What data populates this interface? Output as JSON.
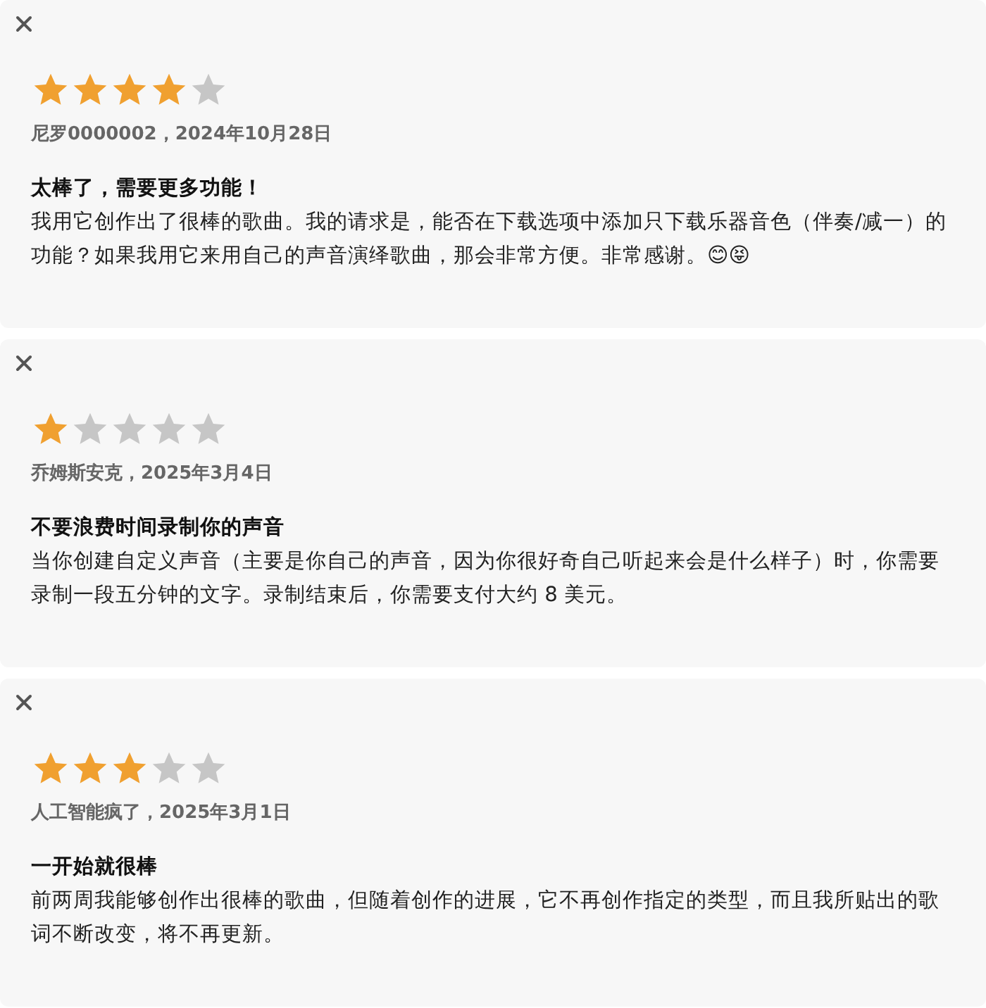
{
  "reviews": [
    {
      "stars": 4,
      "author_date": "尼罗0000002，2024年10月28日",
      "title": "太棒了，需要更多功能！",
      "body": "我用它创作出了很棒的歌曲。我的请求是，能否在下载选项中添加只下载乐器音色（伴奏/减一）的功能？如果我用它来用自己的声音演绎歌曲，那会非常方便。非常感谢。😊😝"
    },
    {
      "stars": 1,
      "author_date": "乔姆斯安克，2025年3月4日",
      "title": "不要浪费时间录制你的声音",
      "body": "当你创建自定义声音（主要是你自己的声音，因为你很好奇自己听起来会是什么样子）时，你需要录制一段五分钟的文字。录制结束后，你需要支付大约 8 美元。"
    },
    {
      "stars": 3,
      "author_date": "人工智能疯了，2025年3月1日",
      "title": "一开始就很棒",
      "body": "前两周我能够创作出很棒的歌曲，但随着创作的进展，它不再创作指定的类型，而且我所贴出的歌词不断改变，将不再更新。"
    }
  ]
}
